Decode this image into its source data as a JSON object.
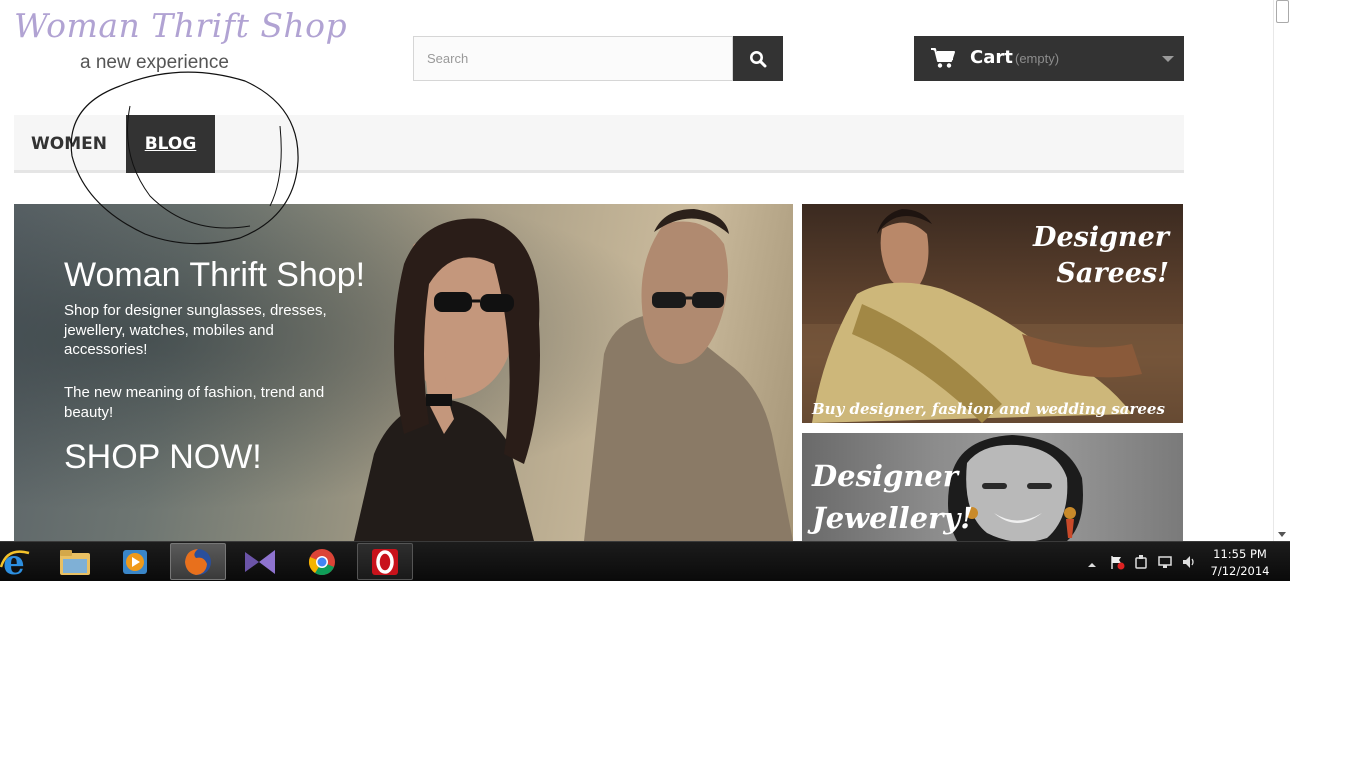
{
  "header": {
    "logo_title": "Woman Thrift Shop",
    "logo_tagline": "a new experience",
    "search_placeholder": "Search",
    "cart_label": "Cart",
    "cart_status": "(empty)"
  },
  "nav": {
    "items": [
      {
        "label": "WOMEN"
      },
      {
        "label": "BLOG",
        "active": true
      }
    ]
  },
  "hero": {
    "title": "Woman Thrift Shop!",
    "paragraph1": "Shop for designer sunglasses, dresses, jewellery, watches, mobiles and accessories!",
    "paragraph2": "The new meaning of fashion, trend and beauty!",
    "cta": "SHOP NOW!"
  },
  "banners": [
    {
      "title_line1": "Designer",
      "title_line2": "Sarees!",
      "subtitle": "Buy designer, fashion and wedding sarees"
    },
    {
      "title_line1": "Designer",
      "title_line2": "Jewellery!"
    }
  ],
  "taskbar": {
    "apps": [
      "internet-explorer",
      "file-explorer",
      "media-player",
      "firefox",
      "visual-studio",
      "chrome",
      "opera"
    ],
    "active_app": "firefox",
    "clock_time": "11:55 PM",
    "clock_date": "7/12/2014"
  },
  "colors": {
    "logo": "#b1a3d3",
    "dark_ui": "#333333",
    "nav_bg": "#f6f6f6"
  }
}
